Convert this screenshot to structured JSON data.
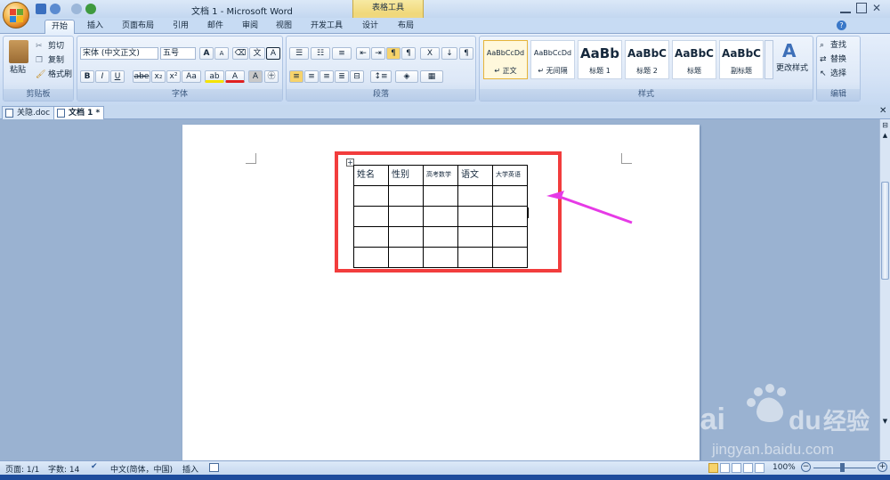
{
  "titlebar": {
    "title": "文档 1 - Microsoft Word",
    "context_label": "表格工具"
  },
  "tabs": [
    {
      "label": "开始",
      "active": true
    },
    {
      "label": "插入"
    },
    {
      "label": "页面布局"
    },
    {
      "label": "引用"
    },
    {
      "label": "邮件"
    },
    {
      "label": "审阅"
    },
    {
      "label": "视图"
    },
    {
      "label": "开发工具"
    },
    {
      "label": "设计"
    },
    {
      "label": "布局"
    }
  ],
  "clipboard": {
    "paste": "粘贴",
    "cut": "剪切",
    "copy": "复制",
    "format_painter": "格式刷",
    "title": "剪贴板"
  },
  "font": {
    "name": "宋体 (中文正文)",
    "size": "五号",
    "title": "字体",
    "grow": "A",
    "shrink": "A",
    "bold": "B",
    "italic": "I",
    "underline": "U",
    "strike": "abe",
    "sub": "x₂",
    "sup": "x²",
    "case": "Aa",
    "color": "A",
    "charbox": "A"
  },
  "paragraph": {
    "title": "段落"
  },
  "styles": {
    "title": "样式",
    "items": [
      {
        "preview": "AaBbCcDd",
        "name": "↵ 正文"
      },
      {
        "preview": "AaBbCcDd",
        "name": "↵ 无间隔"
      },
      {
        "preview": "AaBb",
        "name": "标题 1"
      },
      {
        "preview": "AaBbC",
        "name": "标题 2"
      },
      {
        "preview": "AaBbC",
        "name": "标题"
      },
      {
        "preview": "AaBbC",
        "name": "副标题"
      }
    ],
    "change": "更改样式"
  },
  "editing": {
    "find": "查找",
    "replace": "替换",
    "select": "选择",
    "title": "编辑"
  },
  "doc_tabs": [
    {
      "label": "关隐.doc"
    },
    {
      "label": "文档 1 *",
      "active": true
    }
  ],
  "table": {
    "header": [
      "姓名",
      "性别",
      "高考数学",
      "语文",
      "大学英语"
    ],
    "rows": 4
  },
  "status": {
    "page": "页面: 1/1",
    "words": "字数: 14",
    "lang": "中文(简体，中国)",
    "mode": "插入",
    "zoom": "100%"
  },
  "watermark": {
    "brand": "Bai",
    "du": "du",
    "jingyan": "经验",
    "url": "jingyan.baidu.com"
  },
  "colors": {
    "highlight": "#f23d3d",
    "arrow": "#e63ae6"
  }
}
